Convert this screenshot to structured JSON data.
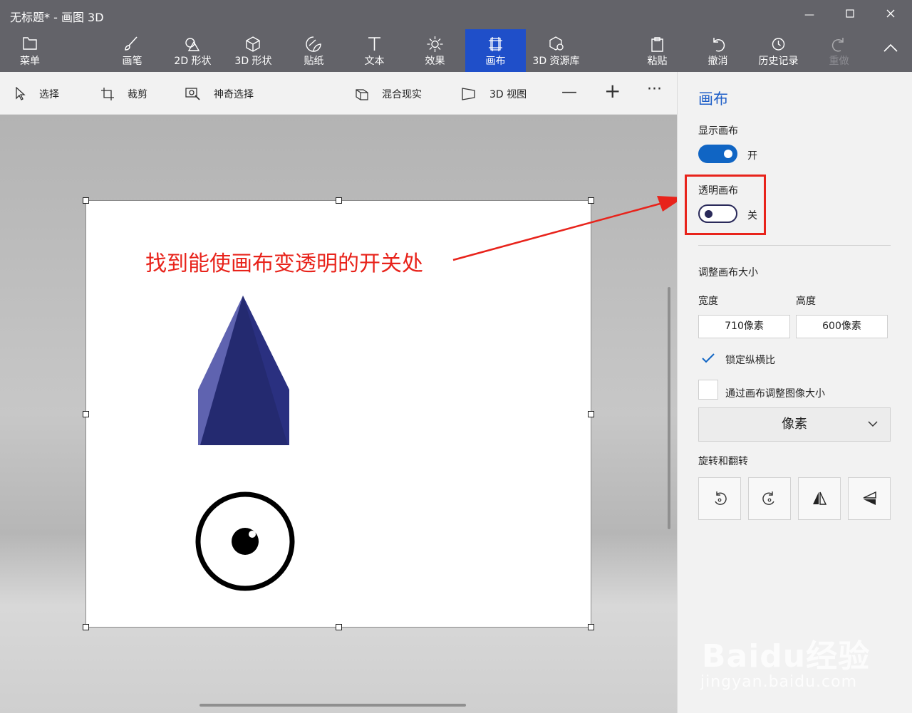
{
  "window": {
    "title": "无标题* - 画图 3D"
  },
  "ribbon": {
    "menu": "菜单",
    "tabs": [
      "画笔",
      "2D 形状",
      "3D 形状",
      "贴纸",
      "文本",
      "效果",
      "画布",
      "3D 资源库"
    ],
    "active_tab": "画布",
    "actions": [
      "粘贴",
      "撤消",
      "历史记录",
      "重做"
    ]
  },
  "toolbar": {
    "select": "选择",
    "crop": "裁剪",
    "magic_select": "神奇选择",
    "mixed_reality": "混合现实",
    "view_3d": "3D 视图",
    "zoom_out": "—",
    "zoom_in": "+",
    "more": "···"
  },
  "annotation": {
    "text": "找到能使画布变透明的开关处",
    "color": "#e8231b"
  },
  "panel": {
    "title": "画布",
    "show_canvas": {
      "label": "显示画布",
      "state": "开",
      "on": true
    },
    "transparent_canvas": {
      "label": "透明画布",
      "state": "关",
      "on": false
    },
    "resize_label": "调整画布大小",
    "width_label": "宽度",
    "height_label": "高度",
    "width_value": "710像素",
    "height_value": "600像素",
    "lock_aspect": {
      "label": "锁定纵横比",
      "checked": true
    },
    "resize_image": {
      "label": "通过画布调整图像大小",
      "checked": false
    },
    "unit": "像素",
    "rotate_label": "旋转和翻转"
  },
  "watermark": {
    "brand": "Baidu经验",
    "url": "jingyan.baidu.com"
  },
  "colors": {
    "accent": "#1f4fc9",
    "ribbon": "#636369",
    "highlight": "#e8231b",
    "panel_title": "#1f5fc8",
    "shape": "#252a6e"
  }
}
